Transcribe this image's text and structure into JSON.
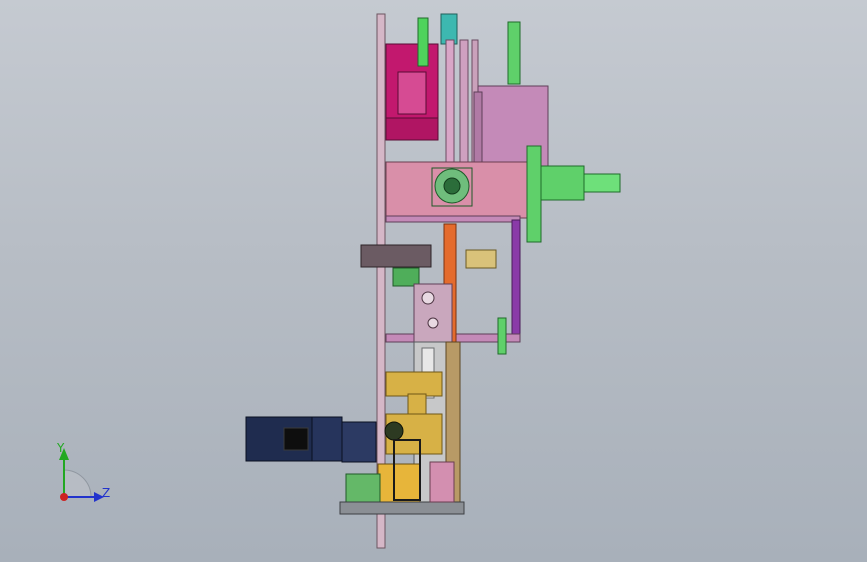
{
  "viewport": {
    "background_top": "#c5cad1",
    "background_bottom": "#a8b0ba"
  },
  "triad": {
    "y_label": "Y",
    "z_label": "Z",
    "y_color": "#22a822",
    "z_color": "#2233cc",
    "x_color": "#cc2222"
  },
  "palette": {
    "magenta": "#c2186e",
    "pink": "#d98fa9",
    "mauve": "#c48ab8",
    "green": "#5fd06a",
    "gold": "#d7b146",
    "navy": "#1f2c4f",
    "orange": "#e46b2d",
    "purple": "#8a3aa8"
  }
}
